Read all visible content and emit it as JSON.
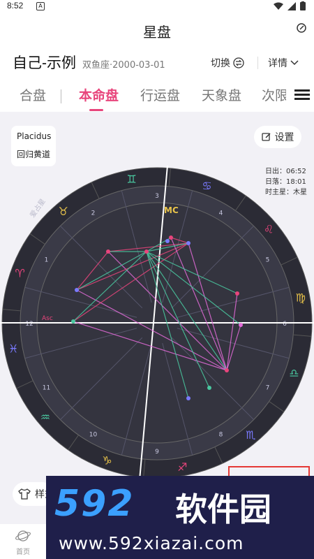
{
  "status_bar": {
    "time": "8:52",
    "notif_icon": "A"
  },
  "title_bar": {
    "title": "星盘"
  },
  "profile": {
    "name": "自己-示例",
    "subtitle": "双鱼座·2000-03-01",
    "switch_label": "切换",
    "detail_label": "详情"
  },
  "tabs": [
    {
      "label": "合盘",
      "active": false
    },
    {
      "label": "本命盘",
      "active": true
    },
    {
      "label": "行运盘",
      "active": false
    },
    {
      "label": "天象盘",
      "active": false
    },
    {
      "label": "次限盘",
      "active": false
    }
  ],
  "house_system": {
    "system": "Placidus",
    "zodiac": "回归黄道"
  },
  "settings_label": "设置",
  "sun_info": {
    "sunrise": "日出：06:52",
    "sunset": "日落：18:01",
    "hour_lord": "时主星：木星"
  },
  "chart": {
    "zodiac_signs": [
      "♈",
      "♉",
      "♊",
      "♋",
      "♌",
      "♍",
      "♎",
      "♏",
      "♐",
      "♑",
      "♒",
      "♓"
    ],
    "house_numbers": [
      "1",
      "2",
      "3",
      "4",
      "5",
      "6",
      "7",
      "8",
      "9",
      "10",
      "11",
      "12"
    ],
    "outer_label": "爱占星",
    "asc_label": "Asc",
    "mc_label": "MC",
    "colors": {
      "fire": "#e8457c",
      "earth": "#e8c34a",
      "air": "#4ac8a0",
      "water": "#7a7aff",
      "dark": "#2e2e3a",
      "ring": "#3f3f4e"
    }
  },
  "style_button": {
    "label": "样式"
  },
  "watermark": {
    "logo": "592",
    "brand": "软件园",
    "domain": "www.592xiazai.com"
  },
  "bottom_nav": {
    "home_label": "首页"
  }
}
